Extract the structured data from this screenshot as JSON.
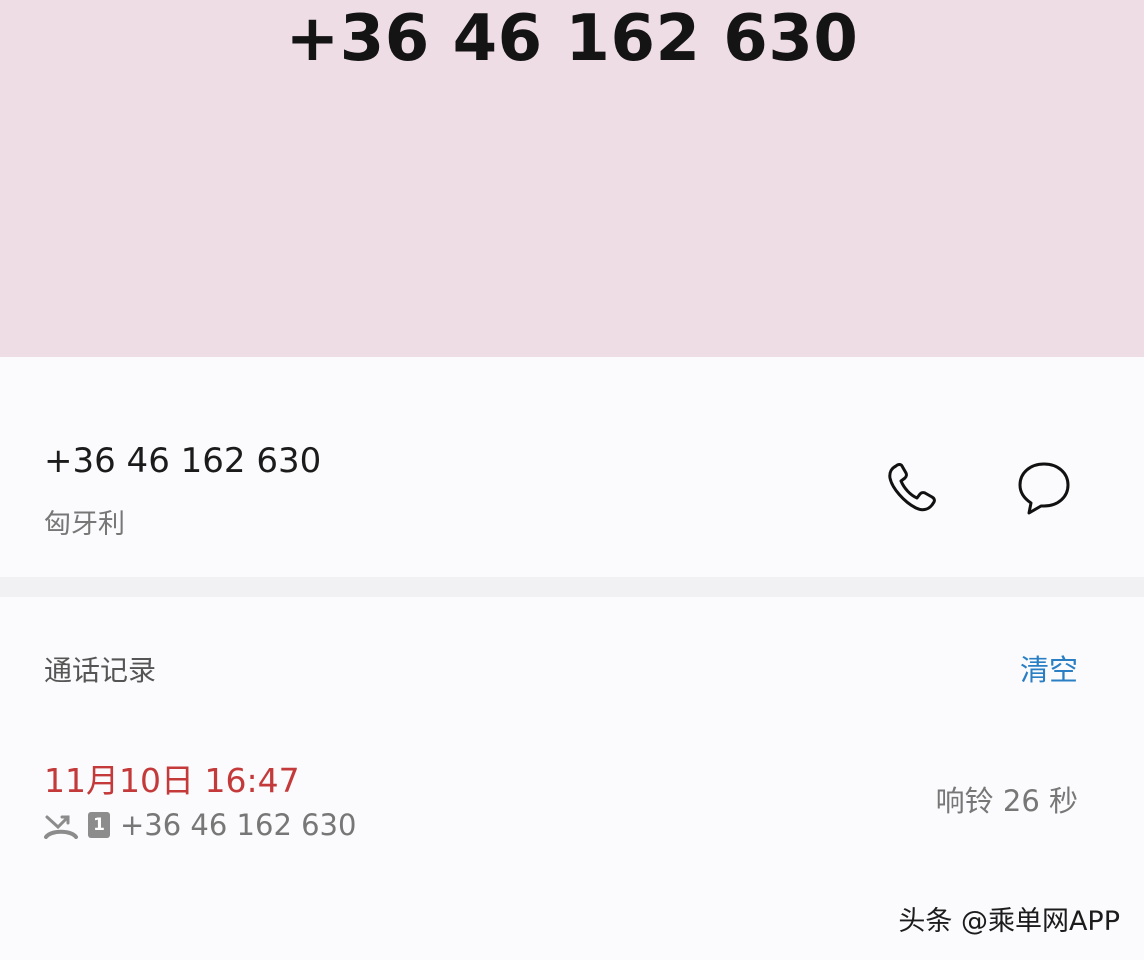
{
  "header": {
    "number": "+36 46 162 630"
  },
  "contact": {
    "number": "+36 46 162 630",
    "location": "匈牙利",
    "call_icon": "phone-icon",
    "message_icon": "message-bubble-icon"
  },
  "history": {
    "title": "通话记录",
    "clear_label": "清空",
    "records": [
      {
        "time": "11月10日 16:47",
        "type_icon": "missed-call-icon",
        "sim": "1",
        "number": "+36 46 162 630",
        "duration": "响铃 26 秒"
      }
    ]
  },
  "watermark": "头条 @乘单网APP",
  "colors": {
    "header_bg": "#efdde6",
    "missed_red": "#c43a3a",
    "accent_blue": "#2a7fc4"
  }
}
